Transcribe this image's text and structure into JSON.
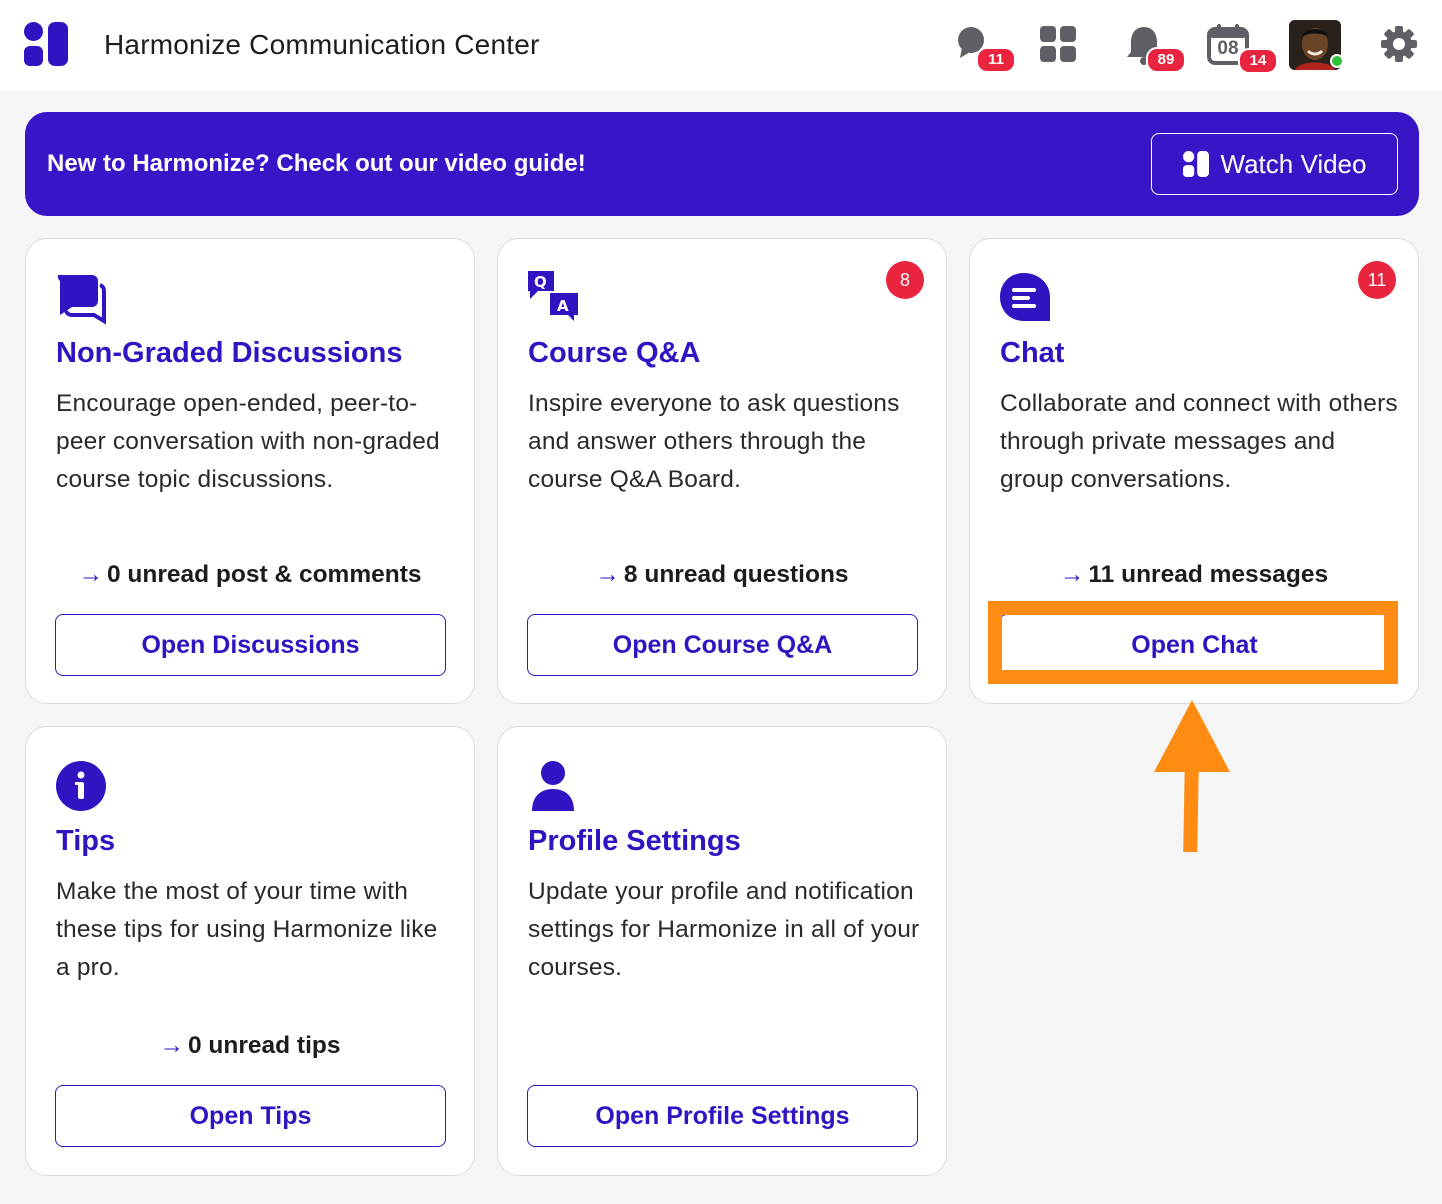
{
  "header": {
    "title": "Harmonize Communication Center",
    "icons": [
      {
        "name": "chat-bubble-icon",
        "badge": "11"
      },
      {
        "name": "apps-grid-icon",
        "badge": ""
      },
      {
        "name": "bell-icon",
        "badge": "89"
      },
      {
        "name": "calendar-icon",
        "day": "08",
        "badge": "14"
      }
    ],
    "settings_icon": "gear-icon"
  },
  "banner": {
    "text": "New to Harmonize? Check out our video guide!",
    "button_label": "Watch Video"
  },
  "cards": [
    {
      "icon": "discussions-icon",
      "title": "Non-Graded Discussions",
      "description": "Encourage open-ended, peer-to-peer conversation with non-graded course topic discussions.",
      "unread": "0 unread post & comments",
      "button": "Open Discussions",
      "badge": ""
    },
    {
      "icon": "qa-icon",
      "title": "Course Q&A",
      "description": "Inspire everyone to ask questions and answer others through the course Q&A Board.",
      "unread": "8 unread questions",
      "button": "Open Course Q&A",
      "badge": "8"
    },
    {
      "icon": "chat-icon",
      "title": "Chat",
      "description": "Collaborate and connect with others through private messages and group conversations.",
      "unread": "11 unread messages",
      "button": "Open Chat",
      "badge": "11"
    },
    {
      "icon": "info-icon",
      "title": "Tips",
      "description": "Make the most of your time with these tips for using Harmonize like a pro.",
      "unread": "0 unread tips",
      "button": "Open Tips",
      "badge": ""
    },
    {
      "icon": "profile-icon",
      "title": "Profile Settings",
      "description": "Update your profile and notification settings for Harmonize in all of your courses.",
      "unread": "",
      "button": "Open Profile Settings",
      "badge": ""
    }
  ],
  "colors": {
    "brand": "#3815c7",
    "accent_text": "#3213c2",
    "badge": "#e8243e",
    "highlight": "#ff8c12",
    "online": "#2ec437"
  }
}
